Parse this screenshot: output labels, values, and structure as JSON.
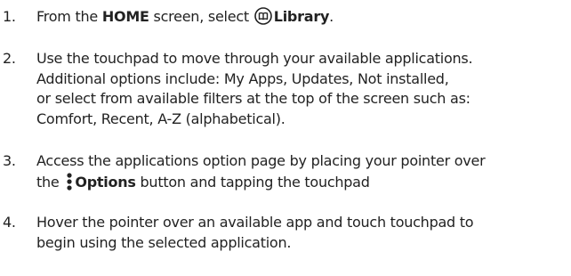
{
  "steps": [
    {
      "number": "1.",
      "parts": {
        "a": "From the ",
        "b": "HOME",
        "c": " screen, select ",
        "d": "Library",
        "e": "."
      },
      "icon": "library-book-icon"
    },
    {
      "number": "2.",
      "lines": [
        "Use the touchpad to move through your available applications.",
        "Additional options include: My Apps, Updates, Not installed,",
        "or select from available filters at the top of the screen such as:",
        "Comfort, Recent, A-Z (alphabetical)."
      ]
    },
    {
      "number": "3.",
      "line1": "Access the applications option page by placing your pointer over",
      "parts": {
        "a": "the ",
        "b": "Options",
        "c": " button and tapping the touchpad"
      },
      "icon": "options-dots-icon"
    },
    {
      "number": "4.",
      "lines": [
        "Hover the pointer over an available app and touch touchpad to",
        "begin using the selected application."
      ]
    }
  ]
}
